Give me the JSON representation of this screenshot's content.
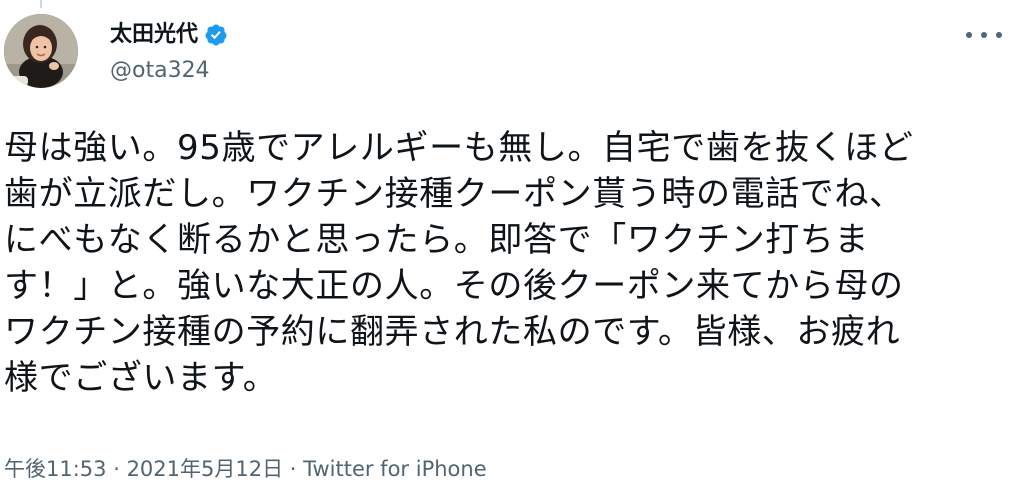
{
  "author": {
    "display_name": "太田光代",
    "handle": "@ota324",
    "verified_icon": "verified-badge-icon",
    "avatar_icon": "avatar-photo"
  },
  "menu": {
    "icon": "more-horizontal-icon"
  },
  "tweet": {
    "lines": [
      "母は強い。95歳でアレルギーも無し。自宅で歯を抜くほど",
      "歯が立派だし。ワクチン接種クーポン貰う時の電話でね、",
      "にべもなく断るかと思ったら。即答で「ワクチン打ちま",
      "す！」と。強いな大正の人。その後クーポン来てから母の",
      "ワクチン接種の予約に翻弄された私のです。皆様、お疲れ",
      "様でございます。"
    ]
  },
  "meta": {
    "time": "午後11:53",
    "separator": " · ",
    "date": "2021年5月12日",
    "source": "Twitter for iPhone"
  },
  "colors": {
    "text_primary": "#0f1419",
    "text_secondary": "#536471",
    "verified_blue": "#1d9bf0"
  }
}
